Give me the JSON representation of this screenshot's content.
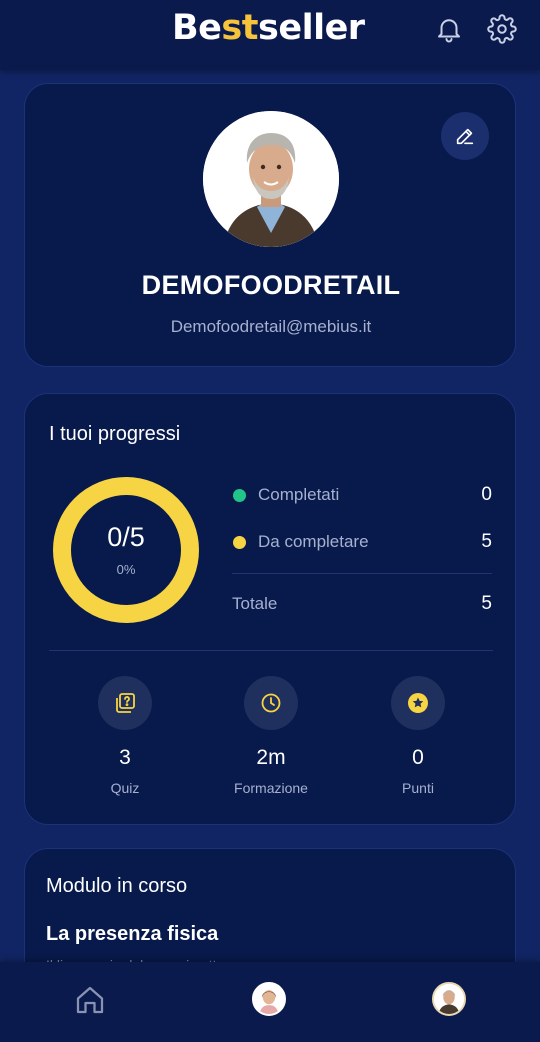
{
  "header": {
    "logo_part1": "Be",
    "logo_part2": "st",
    "logo_part3": "seller",
    "bell_icon": "bell-icon",
    "settings_icon": "gear-icon"
  },
  "profile": {
    "name": "DEMOFOODRETAIL",
    "email": "Demofoodretail@mebius.it",
    "edit_icon": "pencil-icon"
  },
  "progress": {
    "title": "I tuoi progressi",
    "ring_value": "0/5",
    "ring_percent": "0%",
    "completed_fraction": 0,
    "legend": [
      {
        "label": "Completati",
        "count": "0",
        "color": "#22c48a"
      },
      {
        "label": "Da completare",
        "count": "5",
        "color": "#f7d443"
      }
    ],
    "total_label": "Totale",
    "total_count": "5",
    "stats": [
      {
        "icon": "quiz-icon",
        "value": "3",
        "label": "Quiz"
      },
      {
        "icon": "clock-icon",
        "value": "2m",
        "label": "Formazione"
      },
      {
        "icon": "star-icon",
        "value": "0",
        "label": "Punti"
      }
    ]
  },
  "module": {
    "title": "Modulo in corso",
    "subtitle": "La presenza fisica",
    "description": "Il linguaggio del corpo in attesa"
  },
  "nav": {
    "items": [
      "home-icon",
      "assistant-avatar",
      "profile-avatar"
    ]
  },
  "colors": {
    "background": "#112565",
    "card": "#081a4b",
    "accent_yellow": "#f7d443",
    "accent_green": "#22c48a"
  }
}
